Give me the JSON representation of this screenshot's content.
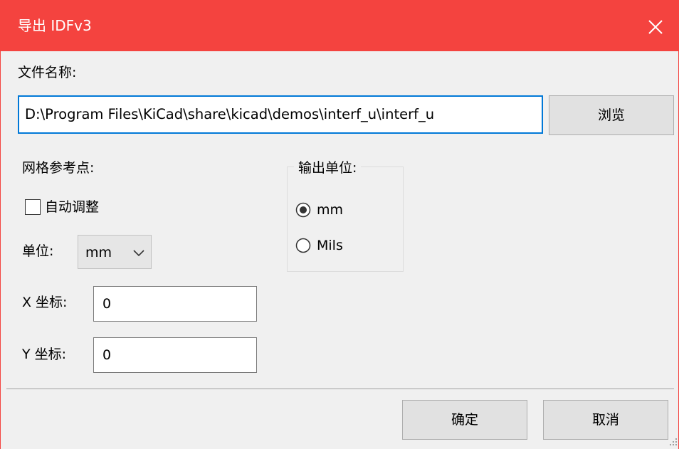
{
  "window": {
    "title": "导出 IDFv3",
    "close_icon": "close-icon",
    "titlebar_color": "#f4433f"
  },
  "file": {
    "label": "文件名称:",
    "path_value": "D:\\Program Files\\KiCad\\share\\kicad\\demos\\interf_u\\interf_u",
    "browse_label": "浏览"
  },
  "grid_ref": {
    "heading": "网格参考点:",
    "auto_adjust_label": "自动调整",
    "auto_adjust_checked": false,
    "unit_label": "单位:",
    "unit_selected": "mm",
    "x_label": "X 坐标:",
    "x_value": "0",
    "y_label": "Y 坐标:",
    "y_value": "0"
  },
  "output_units": {
    "title": "输出单位:",
    "options": [
      {
        "label": "mm",
        "selected": true
      },
      {
        "label": "Mils",
        "selected": false
      }
    ]
  },
  "footer": {
    "ok_label": "确定",
    "cancel_label": "取消"
  },
  "accent_color": "#0078d7"
}
